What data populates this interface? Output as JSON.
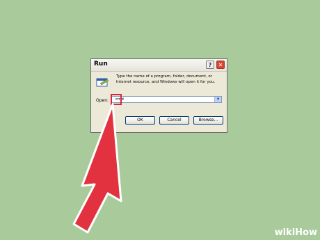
{
  "dialog": {
    "title": "Run",
    "help_button": "?",
    "close_button": "✕",
    "description": "Type the name of a program, folder, document, or Internet resource, and Windows will open it for you.",
    "open_label": "Open:",
    "open_value": "cmd",
    "buttons": {
      "ok": "OK",
      "cancel": "Cancel",
      "browse": "Browse..."
    }
  },
  "icons": {
    "run": "run-icon",
    "arrow": "red-arrow-pointer",
    "dropdown": "chevron-down-icon"
  },
  "colors": {
    "background": "#a9cb9b",
    "highlight": "#d7263d",
    "arrow": "#e23240"
  },
  "watermark": {
    "text": "wikiHow"
  }
}
